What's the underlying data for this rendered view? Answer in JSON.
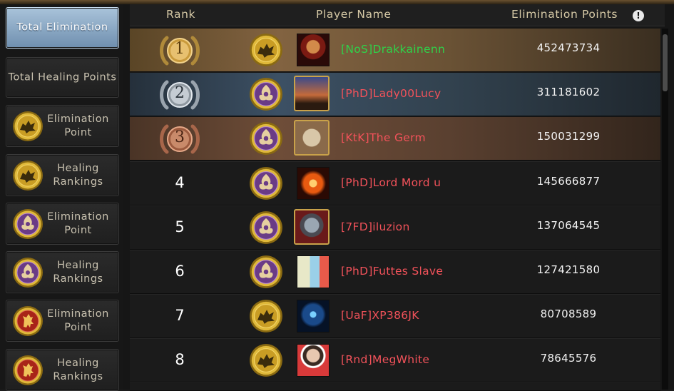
{
  "sidebar": {
    "items": [
      {
        "label": "Total Elimination",
        "active": true,
        "icon": null
      },
      {
        "label": "Total Healing Points",
        "active": false,
        "icon": null
      },
      {
        "label": "Elimination Point",
        "active": false,
        "icon": "gold-wolf-sigil-icon"
      },
      {
        "label": "Healing Rankings",
        "active": false,
        "icon": "gold-wolf-sigil-icon"
      },
      {
        "label": "Elimination Point",
        "active": false,
        "icon": "purple-dragon-sigil-icon"
      },
      {
        "label": "Healing Rankings",
        "active": false,
        "icon": "purple-dragon-sigil-icon"
      },
      {
        "label": "Elimination Point",
        "active": false,
        "icon": "red-lion-sigil-icon"
      },
      {
        "label": "Healing Rankings",
        "active": false,
        "icon": "red-lion-sigil-icon"
      }
    ]
  },
  "table": {
    "headers": {
      "rank": "Rank",
      "player": "Player Name",
      "points": "Elimination Points"
    },
    "info_icon": "!",
    "rows": [
      {
        "rank": "1",
        "medal": "gold",
        "faction": "wolf",
        "name": "[NoS]Drakkainenn",
        "name_color": "#2fd24a",
        "points": "452473734"
      },
      {
        "rank": "2",
        "medal": "silver",
        "faction": "dragon",
        "name": "[PhD]Lady00Lucy",
        "name_color": "#f2525a",
        "points": "311181602"
      },
      {
        "rank": "3",
        "medal": "bronze",
        "faction": "dragon",
        "name": "[KtK]The Germ",
        "name_color": "#f2525a",
        "points": "150031299"
      },
      {
        "rank": "4",
        "medal": null,
        "faction": "dragon",
        "name": "[PhD]Lord Mord u",
        "name_color": "#f2525a",
        "points": "145666877"
      },
      {
        "rank": "5",
        "medal": null,
        "faction": "dragon",
        "name": "[7FD]iluzion",
        "name_color": "#f2525a",
        "points": "137064545"
      },
      {
        "rank": "6",
        "medal": null,
        "faction": "dragon",
        "name": "[PhD]Futtes Slave",
        "name_color": "#f2525a",
        "points": "127421580"
      },
      {
        "rank": "7",
        "medal": null,
        "faction": "wolf",
        "name": "[UaF]XP386JK",
        "name_color": "#f2525a",
        "points": "80708589"
      },
      {
        "rank": "8",
        "medal": null,
        "faction": "wolf",
        "name": "[Rnd]MegWhite",
        "name_color": "#f2525a",
        "points": "78645576"
      }
    ]
  },
  "colors": {
    "gold_row": "#826341",
    "silver_row": "#3c5064",
    "bronze_row": "#6e4d38",
    "active_tab": "#8fadc9",
    "header_text": "#d6c9a6"
  }
}
